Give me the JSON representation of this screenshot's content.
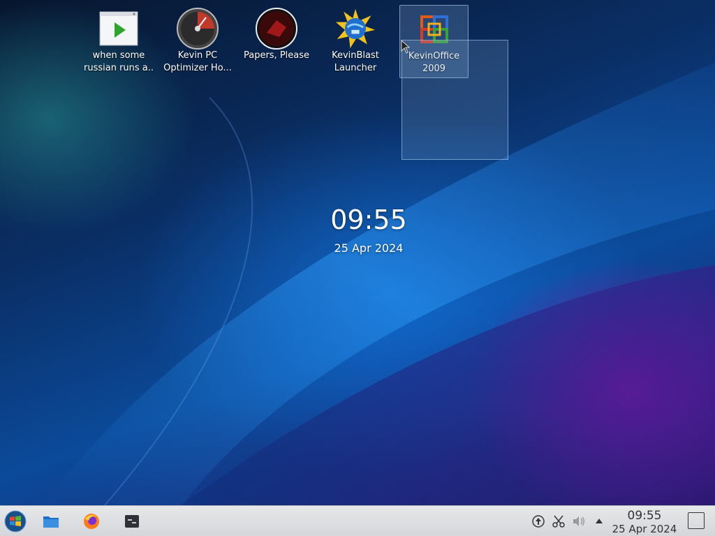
{
  "desktop_icons": [
    {
      "label_line1": "when some",
      "label_line2": "russian runs a...",
      "icon": "video-player-icon"
    },
    {
      "label_line1": "Kevin PC",
      "label_line2": "Optimizer Ho...",
      "icon": "speedometer-icon"
    },
    {
      "label_line1": "Papers, Please",
      "label_line2": "",
      "icon": "papers-please-seal-icon"
    },
    {
      "label_line1": "KevinBlast",
      "label_line2": "Launcher",
      "icon": "globe-sun-icon"
    },
    {
      "label_line1": "KevinOffice",
      "label_line2": "2009",
      "icon": "office-logo-icon",
      "selected": true
    }
  ],
  "clock_widget": {
    "time": "09:55",
    "date": "25 Apr 2024"
  },
  "taskbar": {
    "start_icon": "start-orb-icon",
    "pinned": [
      {
        "name": "file-manager",
        "icon": "folder-icon"
      },
      {
        "name": "firefox",
        "icon": "firefox-icon"
      },
      {
        "name": "terminal",
        "icon": "terminal-icon"
      }
    ],
    "tray": [
      {
        "name": "updates",
        "icon": "update-arrow-icon"
      },
      {
        "name": "clipboard",
        "icon": "scissors-icon"
      },
      {
        "name": "volume",
        "icon": "speaker-icon"
      },
      {
        "name": "expand",
        "icon": "arrow-up-icon"
      }
    ],
    "clock": {
      "time": "09:55",
      "date": "25 Apr 2024"
    }
  },
  "colors": {
    "taskbar_bg": "#dcdee1",
    "selection": "#8cb4dc"
  }
}
